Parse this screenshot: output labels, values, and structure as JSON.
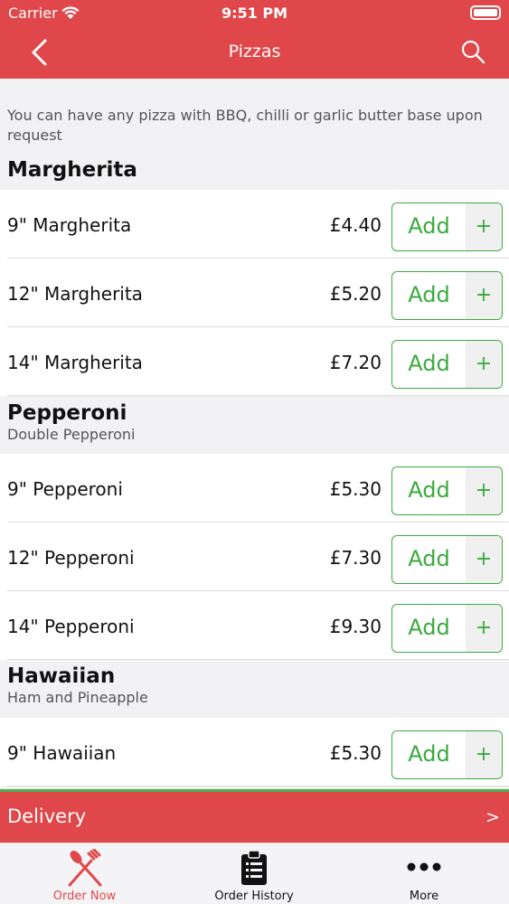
{
  "status_bar": {
    "carrier": "Carrier",
    "time": "9:51 PM"
  },
  "nav": {
    "title": "Pizzas"
  },
  "intro_text": "You can have any pizza with BBQ, chilli or garlic butter base upon request",
  "sections": [
    {
      "name": "Margherita",
      "description": "",
      "items": [
        {
          "name": "9\" Margherita",
          "price": "£4.40",
          "add_label": "Add",
          "plus": "+"
        },
        {
          "name": "12\" Margherita",
          "price": "£5.20",
          "add_label": "Add",
          "plus": "+"
        },
        {
          "name": "14\" Margherita",
          "price": "£7.20",
          "add_label": "Add",
          "plus": "+"
        }
      ]
    },
    {
      "name": "Pepperoni",
      "description": "Double Pepperoni",
      "items": [
        {
          "name": "9\" Pepperoni",
          "price": "£5.30",
          "add_label": "Add",
          "plus": "+"
        },
        {
          "name": "12\" Pepperoni",
          "price": "£7.30",
          "add_label": "Add",
          "plus": "+"
        },
        {
          "name": "14\" Pepperoni",
          "price": "£9.30",
          "add_label": "Add",
          "plus": "+"
        }
      ]
    },
    {
      "name": "Hawaiian",
      "description": "Ham and Pineapple",
      "items": [
        {
          "name": "9\" Hawaiian",
          "price": "£5.30",
          "add_label": "Add",
          "plus": "+"
        }
      ]
    }
  ],
  "delivery": {
    "label": "Delivery",
    "arrow": ">"
  },
  "tabs": [
    {
      "label": "Order Now",
      "icon": "fork-knife-icon",
      "active": true
    },
    {
      "label": "Order History",
      "icon": "clipboard-list-icon",
      "active": false
    },
    {
      "label": "More",
      "icon": "more-dots-icon",
      "active": false
    }
  ],
  "colors": {
    "brand": "#e0474a",
    "accent_green": "#3aaa3c",
    "active_tab": "#e0474a",
    "inactive_tab": "#111111"
  }
}
